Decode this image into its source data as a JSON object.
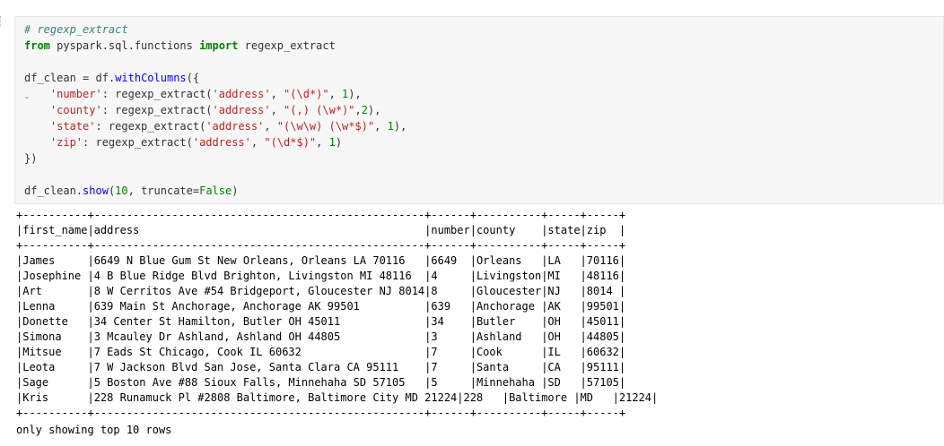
{
  "cell": {
    "code_lines": [
      "# regexp_extract",
      "from pyspark.sql.functions import regexp_extract",
      "",
      "df_clean = df.withColumns({",
      "    'number': regexp_extract('address', \"(\\d*)\", 1),",
      "    'county': regexp_extract('address', \"(,) (\\w*)\",2),",
      "    'state': regexp_extract('address', \"(\\w\\w) (\\w*$)\", 1),",
      "    'zip': regexp_extract('address', \"(\\d*$)\", 1)",
      "})",
      "",
      "df_clean.show(10, truncate=False)"
    ],
    "collapse_glyph": "⌄"
  },
  "output": {
    "border_line": "+----------+---------------------------------------------------+------+----------+-----+-----+",
    "header_line": "|first_name|address                                            |number|county    |state|zip  |",
    "rows": [
      "|James     |6649 N Blue Gum St New Orleans, Orleans LA 70116   |6649  |Orleans   |LA   |70116|",
      "|Josephine |4 B Blue Ridge Blvd Brighton, Livingston MI 48116  |4     |Livingston|MI   |48116|",
      "|Art       |8 W Cerritos Ave #54 Bridgeport, Gloucester NJ 8014|8     |Gloucester|NJ   |8014 |",
      "|Lenna     |639 Main St Anchorage, Anchorage AK 99501          |639   |Anchorage |AK   |99501|",
      "|Donette   |34 Center St Hamilton, Butler OH 45011             |34    |Butler    |OH   |45011|",
      "|Simona    |3 Mcauley Dr Ashland, Ashland OH 44805             |3     |Ashland   |OH   |44805|",
      "|Mitsue    |7 Eads St Chicago, Cook IL 60632                   |7     |Cook      |IL   |60632|",
      "|Leota     |7 W Jackson Blvd San Jose, Santa Clara CA 95111    |7     |Santa     |CA   |95111|",
      "|Sage      |5 Boston Ave #88 Sioux Falls, Minnehaha SD 57105   |5     |Minnehaha |SD   |57105|",
      "|Kris      |228 Runamuck Pl #2808 Baltimore, Baltimore City MD 21224|228   |Baltimore |MD   |21224|"
    ],
    "footer_note": "only showing top 10 rows"
  }
}
